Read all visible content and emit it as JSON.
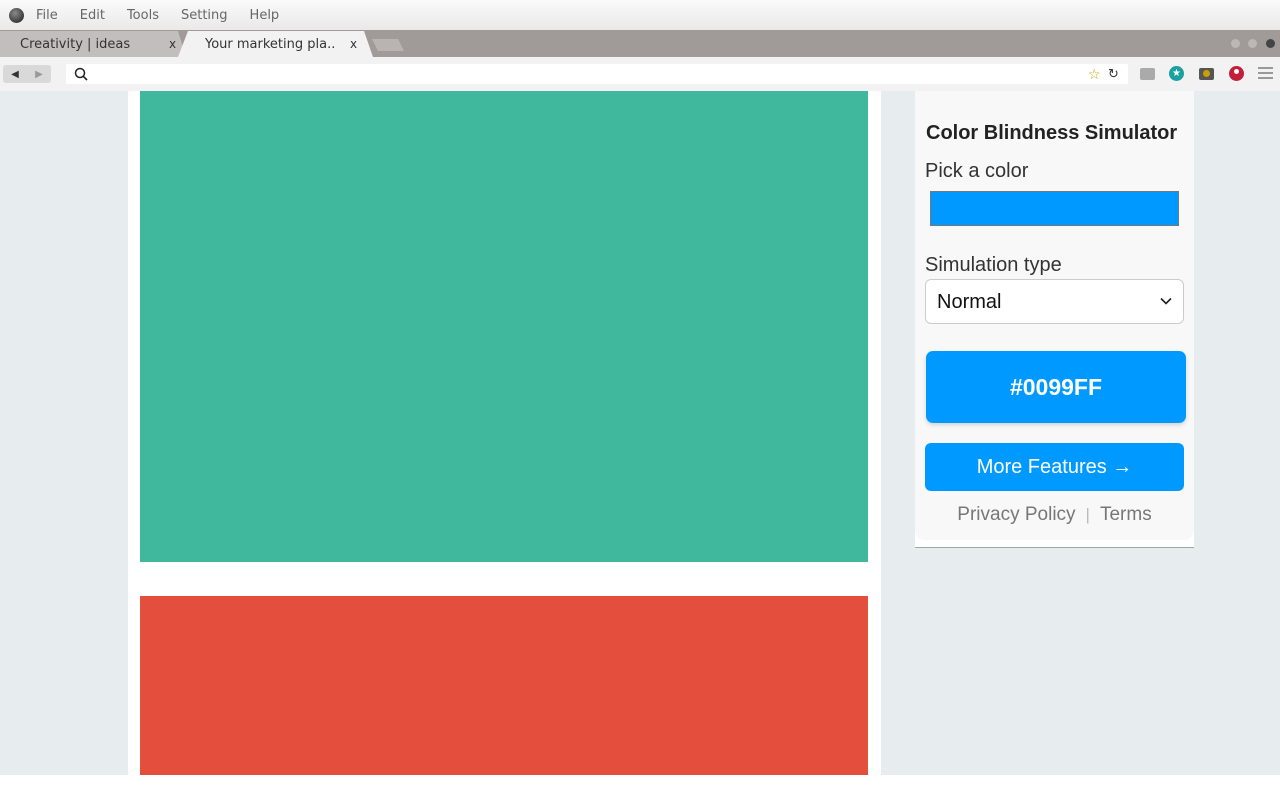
{
  "menubar": {
    "items": [
      "File",
      "Edit",
      "Tools",
      "Setting",
      "Help"
    ]
  },
  "tabs": [
    {
      "title": "Creativity  |  ideas",
      "close": "x"
    },
    {
      "title": "Your marketing pla..",
      "close": "x"
    }
  ],
  "address_bar": {
    "value": "",
    "placeholder": ""
  },
  "page": {
    "block_colors": {
      "green": "#3fb89e",
      "red": "#e34f3c"
    }
  },
  "extension": {
    "title": "Color Blindness Simulator",
    "pick_label": "Pick a color",
    "picked_color": "#0099ff",
    "simulation_label": "Simulation type",
    "simulation_value": "Normal",
    "hex_display": "#0099FF",
    "more_features": "More Features →",
    "privacy": "Privacy Policy",
    "separator": "|",
    "terms": "Terms",
    "accent": "#0099ff"
  },
  "icons": {
    "app": "app-logo-icon",
    "search": "search-icon",
    "bookmark": "star-icon",
    "reload": "reload-icon",
    "menu": "hamburger-menu-icon"
  }
}
